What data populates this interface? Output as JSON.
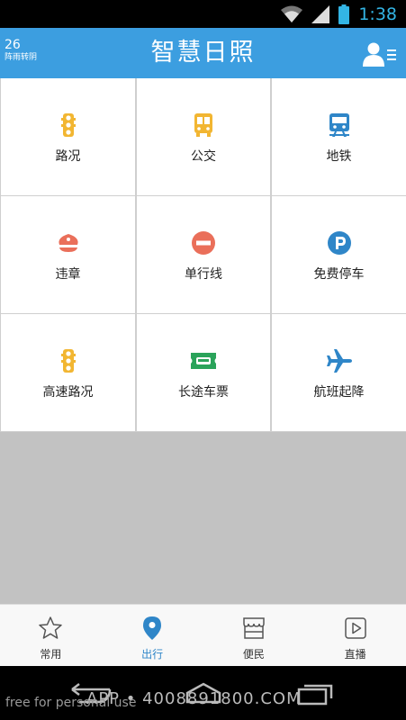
{
  "status_bar": {
    "time": "1:38"
  },
  "header": {
    "weather_temp": "26",
    "weather_desc": "阵雨转阴",
    "title": "智慧日照"
  },
  "grid": [
    {
      "label": "路况",
      "icon": "traffic-light-icon",
      "color": "#f2b632"
    },
    {
      "label": "公交",
      "icon": "bus-icon",
      "color": "#f2b632"
    },
    {
      "label": "地铁",
      "icon": "subway-icon",
      "color": "#2f86c8"
    },
    {
      "label": "违章",
      "icon": "police-cap-icon",
      "color": "#ea6f5a"
    },
    {
      "label": "单行线",
      "icon": "no-entry-icon",
      "color": "#ea6f5a"
    },
    {
      "label": "免费停车",
      "icon": "parking-icon",
      "color": "#2f86c8"
    },
    {
      "label": "高速路况",
      "icon": "traffic-light-icon",
      "color": "#f2b632"
    },
    {
      "label": "长途车票",
      "icon": "ticket-icon",
      "color": "#2aa35a"
    },
    {
      "label": "航班起降",
      "icon": "airplane-icon",
      "color": "#2f86c8"
    }
  ],
  "bottom_nav": [
    {
      "label": "常用",
      "icon": "star-icon"
    },
    {
      "label": "出行",
      "icon": "location-pin-icon",
      "active": true
    },
    {
      "label": "便民",
      "icon": "store-icon"
    },
    {
      "label": "直播",
      "icon": "play-icon"
    }
  ],
  "watermark": {
    "app_text": "APP • 4008891800.COM",
    "free_text": "free for personal use"
  },
  "colors": {
    "header": "#3c9ee0",
    "accent": "#2f86c8",
    "time": "#33b5e5"
  }
}
